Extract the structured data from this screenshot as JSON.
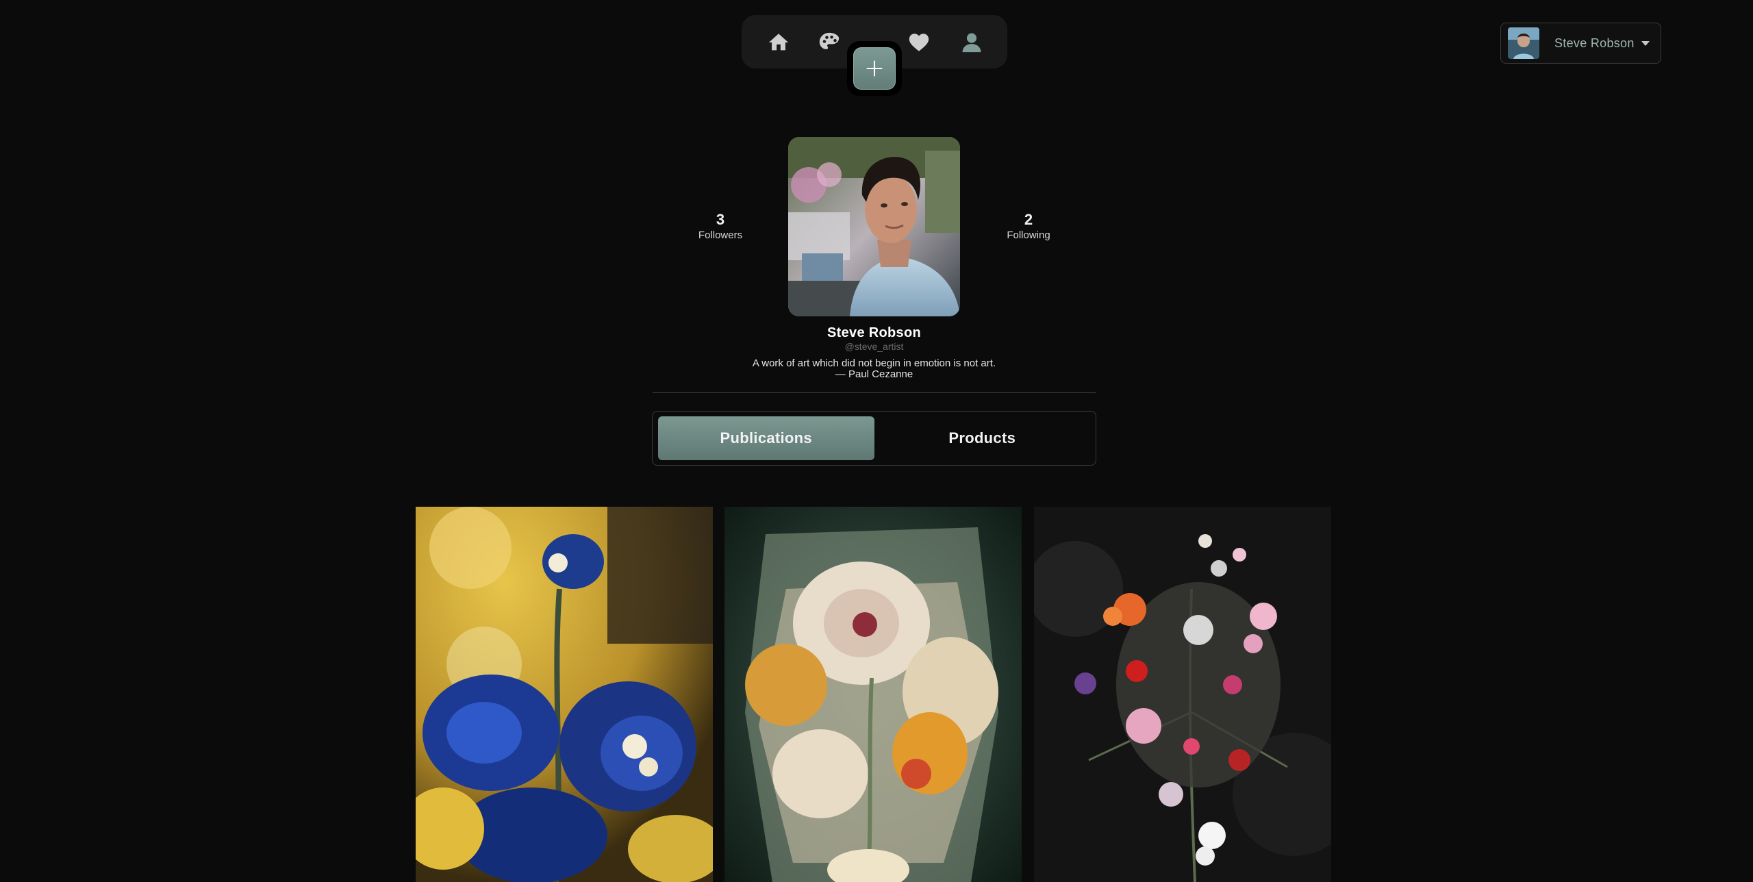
{
  "nav": {
    "items": [
      {
        "name": "home-icon"
      },
      {
        "name": "palette-icon"
      },
      {
        "name": "heart-icon"
      },
      {
        "name": "user-icon"
      }
    ],
    "add_icon": "plus-icon"
  },
  "user_menu": {
    "name": "Steve Robson",
    "icon": "chevron-down-icon"
  },
  "profile": {
    "followers_count": "3",
    "followers_label": "Followers",
    "following_count": "2",
    "following_label": "Following",
    "name": "Steve Robson",
    "handle": "@steve_artist",
    "bio": "A work of art which did not begin in emotion is not art. — Paul Cezanne"
  },
  "tabs": [
    {
      "label": "Publications",
      "active": true
    },
    {
      "label": "Products",
      "active": false
    }
  ],
  "colors": {
    "background": "#0b0b0b",
    "accent": "#6f8c86",
    "nav_bg": "#1a1a1a"
  }
}
